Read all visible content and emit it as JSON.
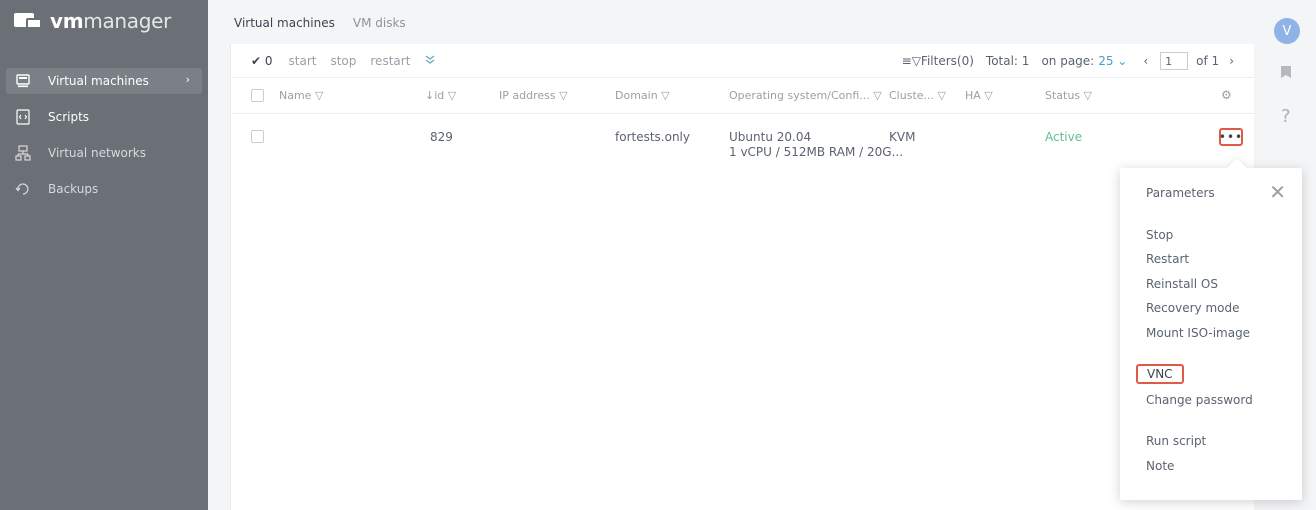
{
  "app": {
    "logo_bold": "vm",
    "logo_light": "manager"
  },
  "sidebar": {
    "items": [
      {
        "label": "Virtual machines",
        "icon": "vm-icon"
      },
      {
        "label": "Scripts",
        "icon": "scripts-icon"
      },
      {
        "label": "Virtual networks",
        "icon": "network-icon"
      },
      {
        "label": "Backups",
        "icon": "backup-icon"
      }
    ]
  },
  "tabs": [
    {
      "label": "Virtual machines"
    },
    {
      "label": "VM disks"
    }
  ],
  "toolbar": {
    "selected_count": "✔ 0",
    "start_label": "start",
    "stop_label": "stop",
    "restart_label": "restart",
    "more_icon": "»",
    "filters_label": "≡▽Filters(0)",
    "total_label": "Total: 1",
    "on_page_label": "on page:",
    "on_page_value": "25 ⌄",
    "prev_page": "‹",
    "page_number": "1",
    "page_of": "of 1",
    "next_page": "›"
  },
  "table": {
    "columns": [
      {
        "label": "Name ▽"
      },
      {
        "label": "↓id ▽"
      },
      {
        "label": "IP address ▽"
      },
      {
        "label": "Domain ▽"
      },
      {
        "label": "Operating system/Confi... ▽"
      },
      {
        "label": "Cluste... ▽"
      },
      {
        "label": "HA ▽"
      },
      {
        "label": "Status ▽"
      },
      {
        "label": "⚙"
      }
    ],
    "rows": [
      {
        "name": "",
        "id": "829",
        "ip": "",
        "domain": "fortests.only",
        "os": "Ubuntu 20.04",
        "config": "1 vCPU / 512MB RAM / 20G...",
        "cluster": "KVM",
        "ha": "",
        "status": "Active",
        "actions": "•••"
      }
    ]
  },
  "rail": {
    "avatar_letter": "V",
    "docs_icon": "▮",
    "help_icon": "?"
  },
  "menu": {
    "close": "✕",
    "items": [
      "Parameters",
      "Stop",
      "Restart",
      "Reinstall OS",
      "Recovery mode",
      "Mount ISO-image",
      "VNC",
      "Change password",
      "Run script",
      "Note"
    ]
  },
  "colors": {
    "sidebar_bg": "#6b6f76",
    "accent": "#4e9cc7",
    "status_active": "#5fbf8c",
    "highlight_border": "#e05a48"
  }
}
